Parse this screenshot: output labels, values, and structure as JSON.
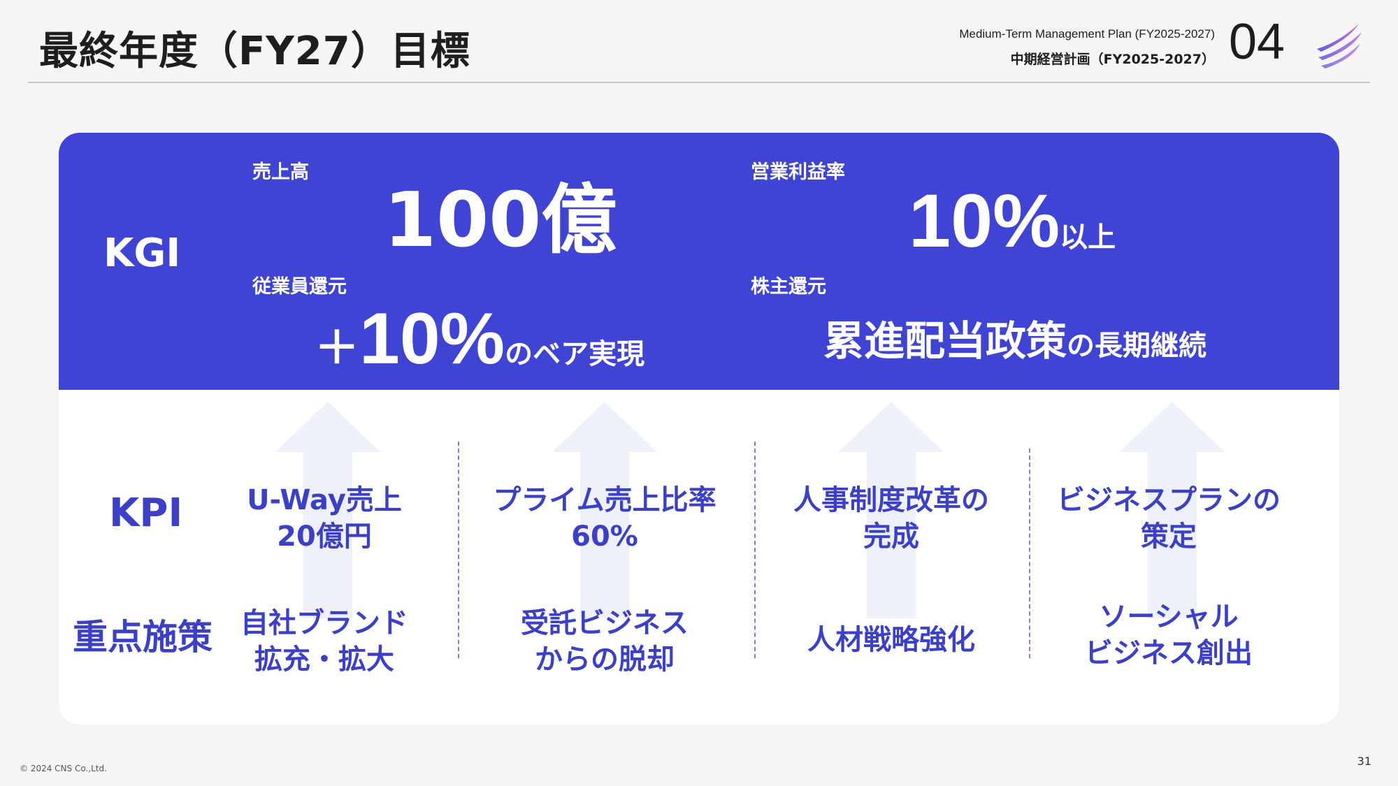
{
  "header": {
    "title": "最終年度（FY27）目標",
    "plan_en": "Medium-Term Management Plan (FY2025-2027)",
    "plan_jp": "中期経営計画（FY2025-2027）",
    "chapter": "04"
  },
  "kgi": {
    "label": "KGI",
    "sales": {
      "label": "売上高",
      "value": "100億"
    },
    "op_margin": {
      "label": "営業利益率",
      "value": "10%",
      "suffix": "以上"
    },
    "employee": {
      "label": "従業員還元",
      "prefix": "＋",
      "value": "10%",
      "suffix": "のベア実現"
    },
    "shareholder": {
      "label": "株主還元",
      "value": "累進配当政策",
      "suffix": "の長期継続"
    }
  },
  "kpi_label": "KPI",
  "measures_label": "重点施策",
  "columns": [
    {
      "kpi_line1": "U-Way売上",
      "kpi_line2": "20億円",
      "measure_line1": "自社ブランド",
      "measure_line2": "拡充・拡大"
    },
    {
      "kpi_line1": "プライム売上比率",
      "kpi_line2": "60%",
      "measure_line1": "受託ビジネス",
      "measure_line2": "からの脱却"
    },
    {
      "kpi_line1": "人事制度改革の",
      "kpi_line2": "完成",
      "measure_line1": "人材戦略強化",
      "measure_line2": ""
    },
    {
      "kpi_line1": "ビジネスプランの",
      "kpi_line2": "策定",
      "measure_line1": "ソーシャル",
      "measure_line2": "ビジネス創出"
    }
  ],
  "footer": {
    "copyright": "© 2024 CNS Co.,Ltd.",
    "page": "31"
  },
  "colors": {
    "accent": "#4044d4",
    "text_accent": "#3c40c6",
    "arrow": "#eef0fa",
    "background": "#f5f5f5"
  }
}
